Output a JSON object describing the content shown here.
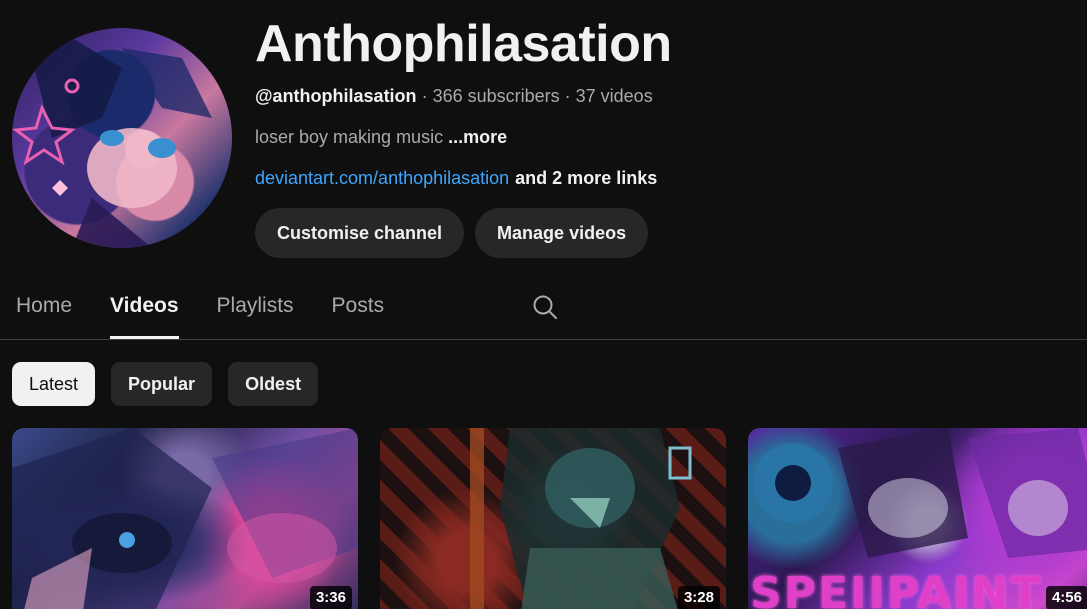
{
  "channel": {
    "title": "Anthophilasation",
    "handle": "@anthophilasation",
    "subscribers": "366 subscribers",
    "videos_count": "37 videos",
    "separator": "·",
    "description": "loser boy making music",
    "description_more": "...more",
    "link": "deviantart.com/anthophilasation",
    "more_links": "and 2 more links"
  },
  "actions": {
    "customise_label": "Customise channel",
    "manage_label": "Manage videos"
  },
  "tabs": [
    {
      "label": "Home",
      "active": false
    },
    {
      "label": "Videos",
      "active": true
    },
    {
      "label": "Playlists",
      "active": false
    },
    {
      "label": "Posts",
      "active": false
    }
  ],
  "search_icon": "search-icon",
  "chips": [
    {
      "label": "Latest",
      "selected": true
    },
    {
      "label": "Popular",
      "selected": false
    },
    {
      "label": "Oldest",
      "selected": false
    }
  ],
  "videos": [
    {
      "duration": "3:36"
    },
    {
      "duration": "3:28"
    },
    {
      "duration": "4:56",
      "thumbnail_text": "SPEIIPAINT"
    }
  ],
  "colors": {
    "background": "#0f0f0f",
    "link": "#3ea6ff",
    "button": "#272727",
    "chip_selected": "#f1f1f1"
  }
}
